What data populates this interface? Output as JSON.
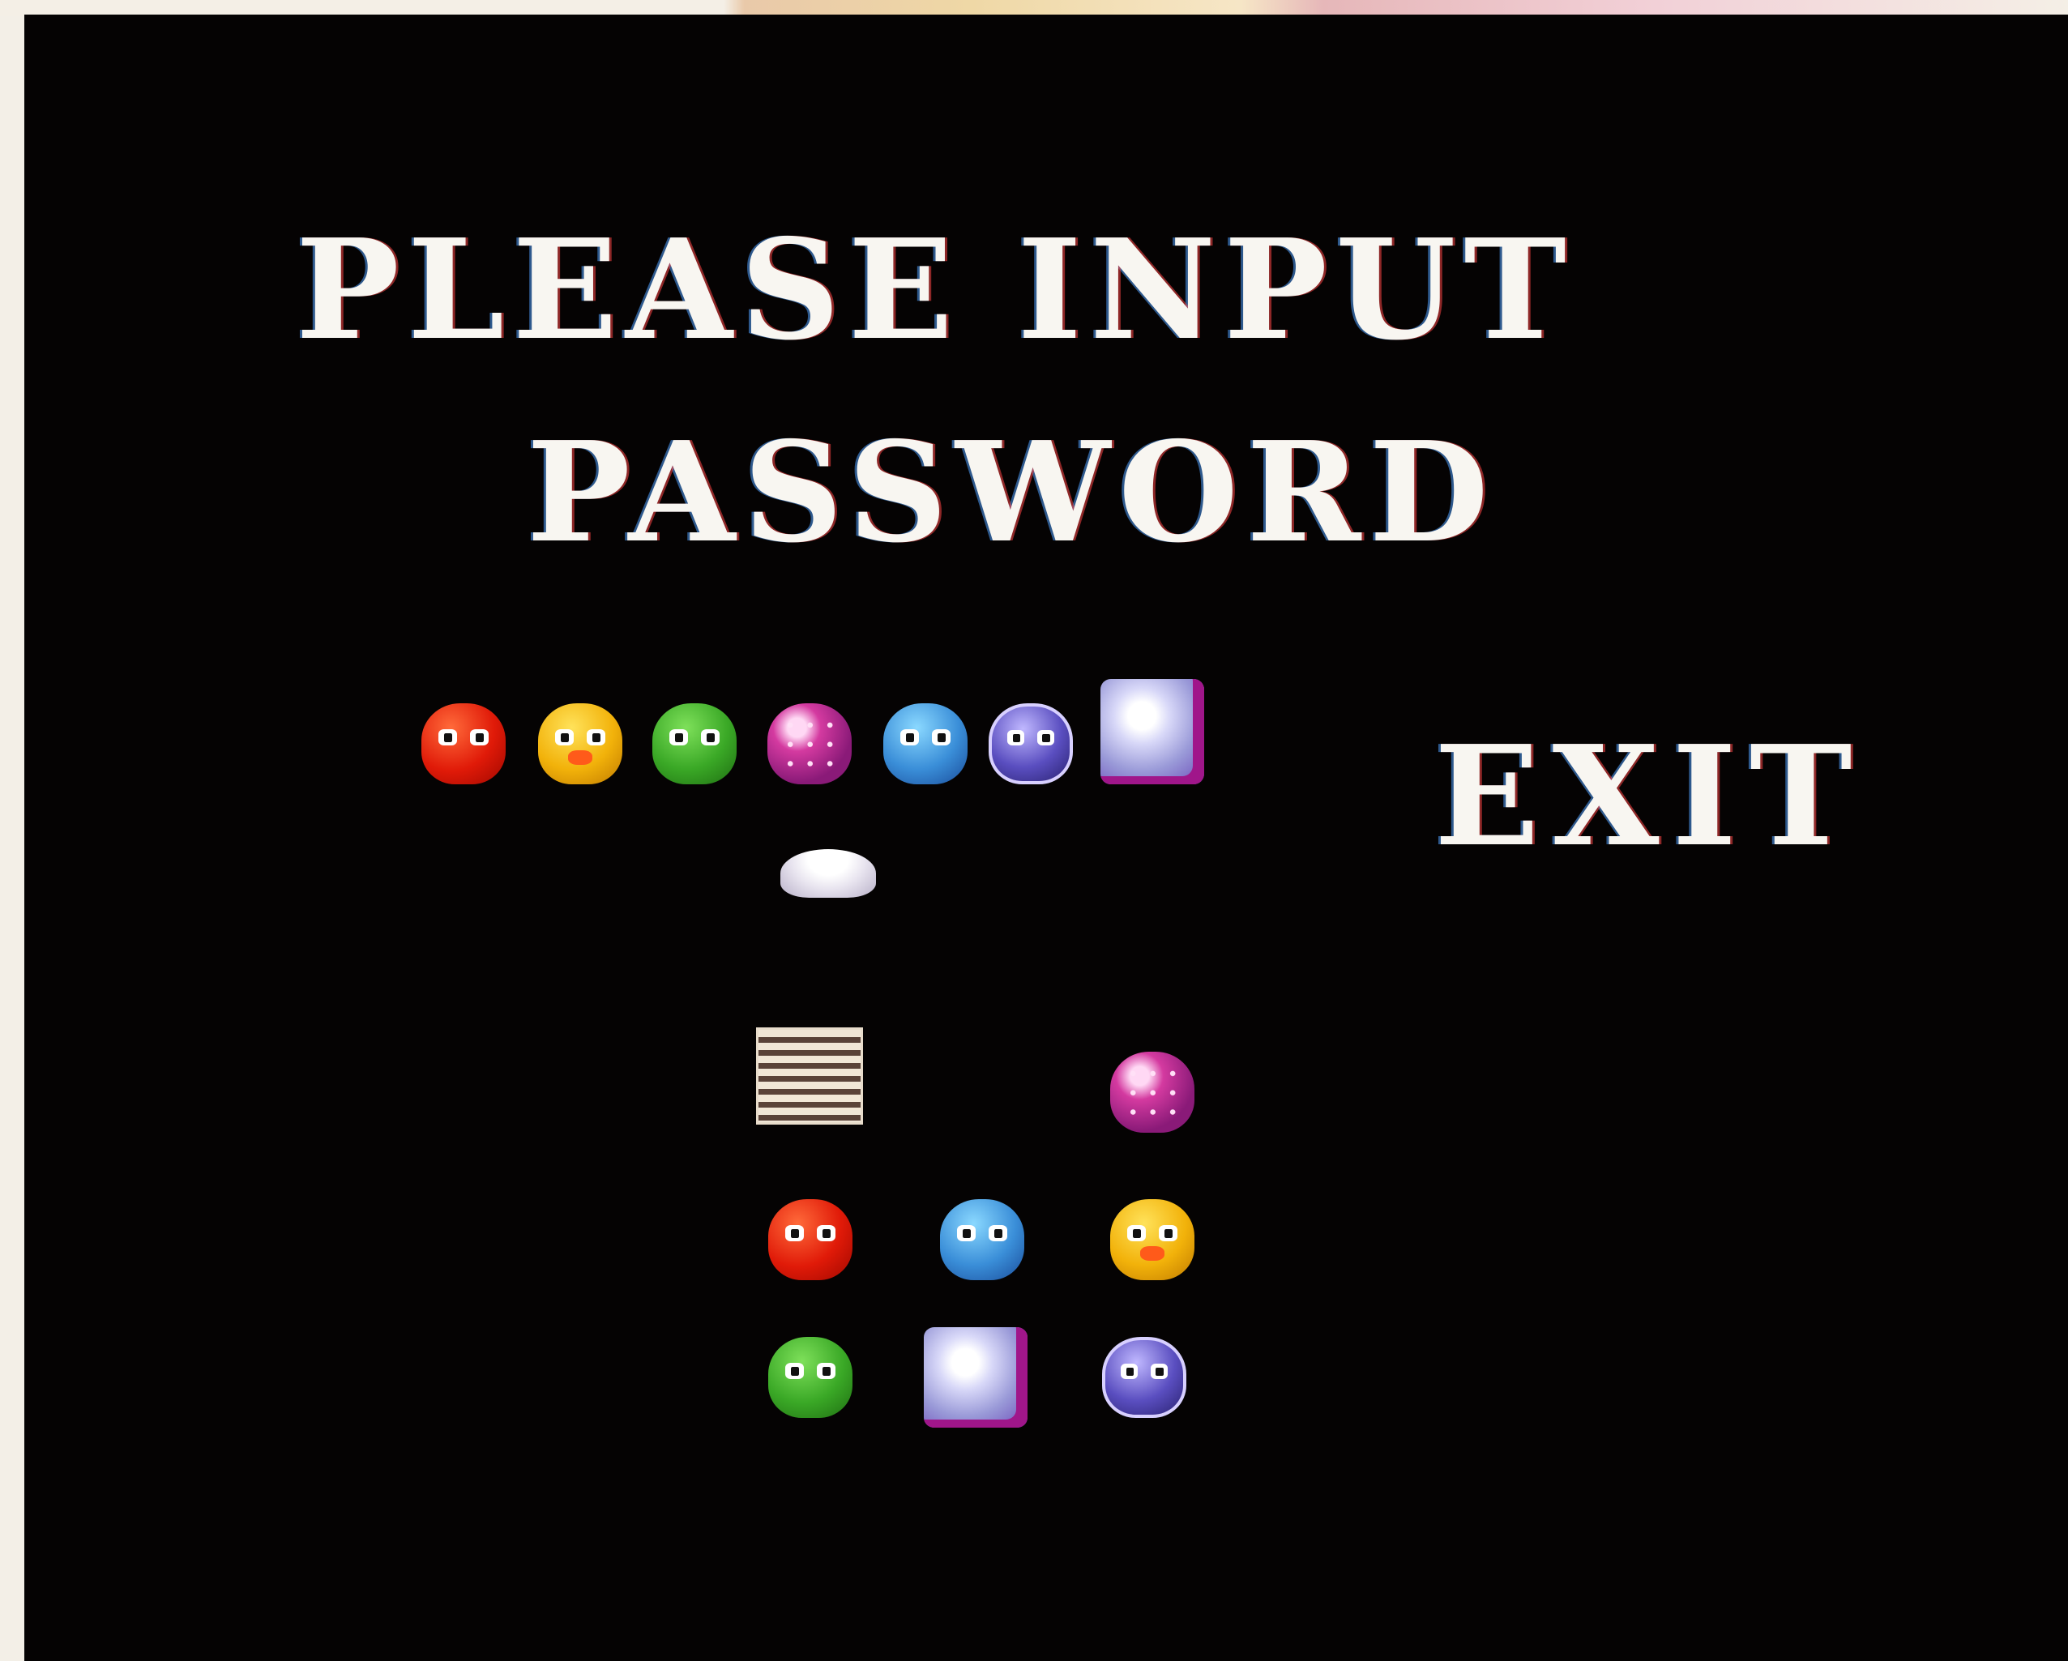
{
  "screen": {
    "title_line1": "PLEASE INPUT",
    "title_line2": "PASSWORD",
    "exit_label": "EXIT"
  },
  "selector_row": {
    "characters": [
      "red-blob",
      "yellow-duck",
      "green-frog",
      "pink-blob",
      "blue-ghost",
      "purple-ghost",
      "white-block"
    ]
  },
  "cursor": {
    "icon": "cloud-cursor-icon",
    "under_character": "pink-blob"
  },
  "password_grid": {
    "slots": [
      [
        "striped-block",
        "",
        "pink-blob"
      ],
      [
        "red-blob",
        "blue-ghost",
        "yellow-duck"
      ],
      [
        "green-frog",
        "white-block",
        "purple-ghost"
      ]
    ]
  },
  "colors": {
    "background": "#050303",
    "text": "#f8f6f1"
  }
}
